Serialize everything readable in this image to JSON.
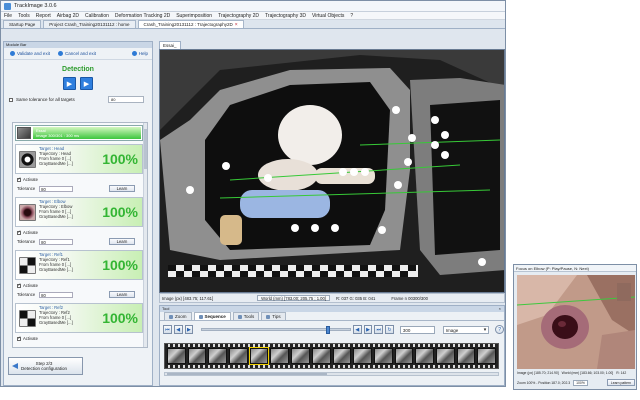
{
  "window": {
    "title": "TrackImage 3.0.6"
  },
  "menu": [
    "File",
    "Tools",
    "Report",
    "Airbag 2D",
    "Calibration",
    "Deformation Tracking 2D",
    "Superimposition",
    "Trajectography 2D",
    "Trajectography 3D",
    "Virtual Objects",
    "?"
  ],
  "doc_tabs": [
    {
      "label": "Startup Page",
      "active": false
    },
    {
      "label": "Project Crash_Training20131112 : home",
      "active": false
    },
    {
      "label": "Crash_Training20131112 : Trajectography2D",
      "active": true
    }
  ],
  "left_panel": {
    "header": "Module Bar",
    "validate_label": "Validate and exit",
    "cancel_label": "Cancel and exit",
    "help_label": "Help",
    "title": "Detection",
    "same_tolerance_label": "Same tolerance for all targets",
    "same_tolerance_value": "80",
    "first_item": {
      "line1": "Essai",
      "line2": "Image 300/301 : 300 ms"
    },
    "targets": [
      {
        "name": "Target : Head",
        "trajectory": "Trajectory : Head",
        "from": "From frame 0 [...]",
        "method": "GrayBasedMe [...]",
        "percent": "100%",
        "activate": "Activate",
        "tolerance_label": "Tolerance",
        "tolerance": "80",
        "learn": "Learn"
      },
      {
        "name": "Target : Elbow",
        "trajectory": "Trajectory : Elbow",
        "from": "From frame 0 [...]",
        "method": "GrayBasedMe [...]",
        "percent": "100%",
        "activate": "Activate",
        "tolerance_label": "Tolerance",
        "tolerance": "80",
        "learn": "Learn"
      },
      {
        "name": "Target : Ref1",
        "trajectory": "Trajectory : Ref1",
        "from": "From frame 0 [...]",
        "method": "GrayBasedMe [...]",
        "percent": "100%",
        "activate": "Activate",
        "tolerance_label": "Tolerance",
        "tolerance": "80",
        "learn": "Learn"
      },
      {
        "name": "Target : Ref2",
        "trajectory": "Trajectory : Ref2",
        "from": "From frame 0 [...]",
        "method": "GrayBasedMe [...]",
        "percent": "100%",
        "activate": "Activate",
        "tolerance_label": "",
        "tolerance": "",
        "learn": ""
      }
    ],
    "step_line1": "Step 2/3",
    "step_line2": "Detection configuration"
  },
  "viewer": {
    "tab": "Essai_",
    "status_image": "Image (px) [483.75; 117.61]",
    "status_world": "World (mm) [783.00; 205.75 ; 1.00]",
    "status_rgb": "R: 037 G: 035 B: 041",
    "status_frame": "Frame n 00300/300"
  },
  "bottom_panel": {
    "header": "Tool",
    "tabs": [
      {
        "label": "Zoom",
        "active": false
      },
      {
        "label": "Sequence",
        "active": true
      },
      {
        "label": "Tools",
        "active": false
      },
      {
        "label": "Tips",
        "active": false
      }
    ],
    "frame_value": "300",
    "mode": "Image"
  },
  "zoom_window": {
    "title": "Focus on Elbow (P: Play/Pause, N: Next)",
    "status_image": "Image (px) [185.70; 214.90]",
    "status_world": "World (mm) [183.66; 103.00; 1.00]",
    "status_rgb": "R: 142",
    "zoom_label": "Zoom 100% - Position 187.0; 202.3",
    "zoom_combo": "100%",
    "learn_button": "Learn pattern"
  },
  "colors": {
    "accent": "#2f7fde",
    "success": "#33b533",
    "panel": "#eef2f6"
  }
}
